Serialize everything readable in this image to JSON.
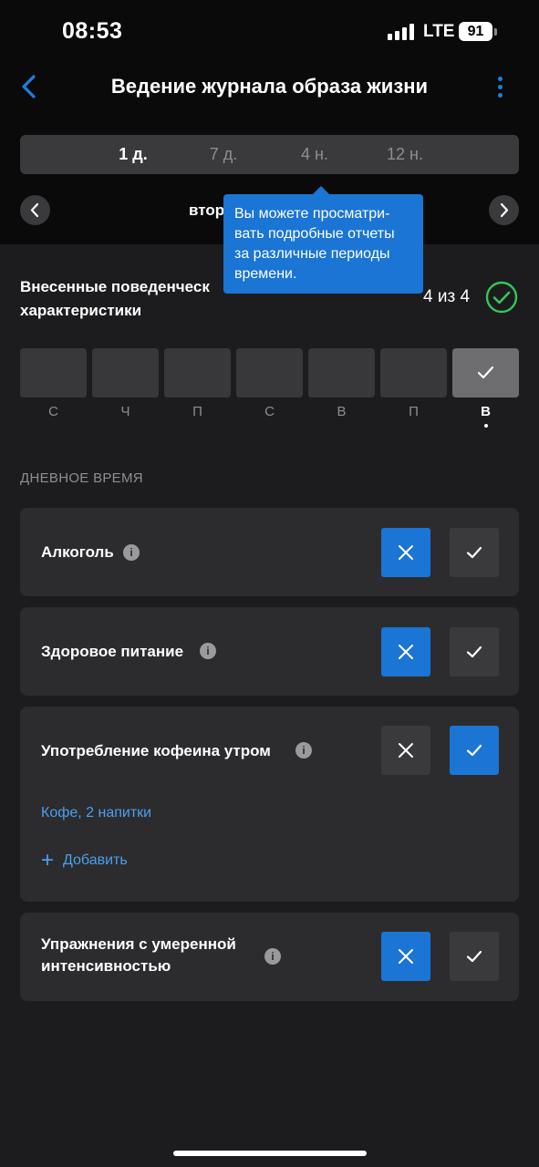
{
  "status_bar": {
    "time": "08:53",
    "network": "LTE",
    "battery": "91"
  },
  "nav": {
    "title": "Ведение журнала образа жизни"
  },
  "periods": [
    {
      "label": "1 д.",
      "active": true
    },
    {
      "label": "7 д.",
      "active": false
    },
    {
      "label": "4 н.",
      "active": false
    },
    {
      "label": "12 н.",
      "active": false
    }
  ],
  "date": {
    "label": "втор"
  },
  "tooltip": {
    "text": "Вы можете просматри-вать подробные отчеты за различные периоды времени."
  },
  "summary": {
    "title": "Внесенные поведенческ характеристики",
    "count": "4 из 4"
  },
  "days": [
    {
      "label": "С",
      "done": false
    },
    {
      "label": "Ч",
      "done": false
    },
    {
      "label": "П",
      "done": false
    },
    {
      "label": "С",
      "done": false
    },
    {
      "label": "В",
      "done": false
    },
    {
      "label": "П",
      "done": false
    },
    {
      "label": "В",
      "done": true,
      "today": true
    }
  ],
  "section": {
    "title": "ДНЕВНОЕ ВРЕМЯ"
  },
  "behaviors": [
    {
      "label": "Алкоголь",
      "answer": "no"
    },
    {
      "label": "Здоровое питание",
      "answer": "no"
    },
    {
      "label": "Употребление кофеина утром",
      "answer": "yes",
      "entry": "Кофе, 2 напитки",
      "add_label": "Добавить"
    },
    {
      "label": "Упражнения с умеренной интенсивностью",
      "answer": "no"
    }
  ],
  "colors": {
    "accent": "#1b75d4",
    "link": "#4a9ff0",
    "success": "#34c759",
    "card": "#2c2c2e",
    "background": "#1c1c1e"
  }
}
